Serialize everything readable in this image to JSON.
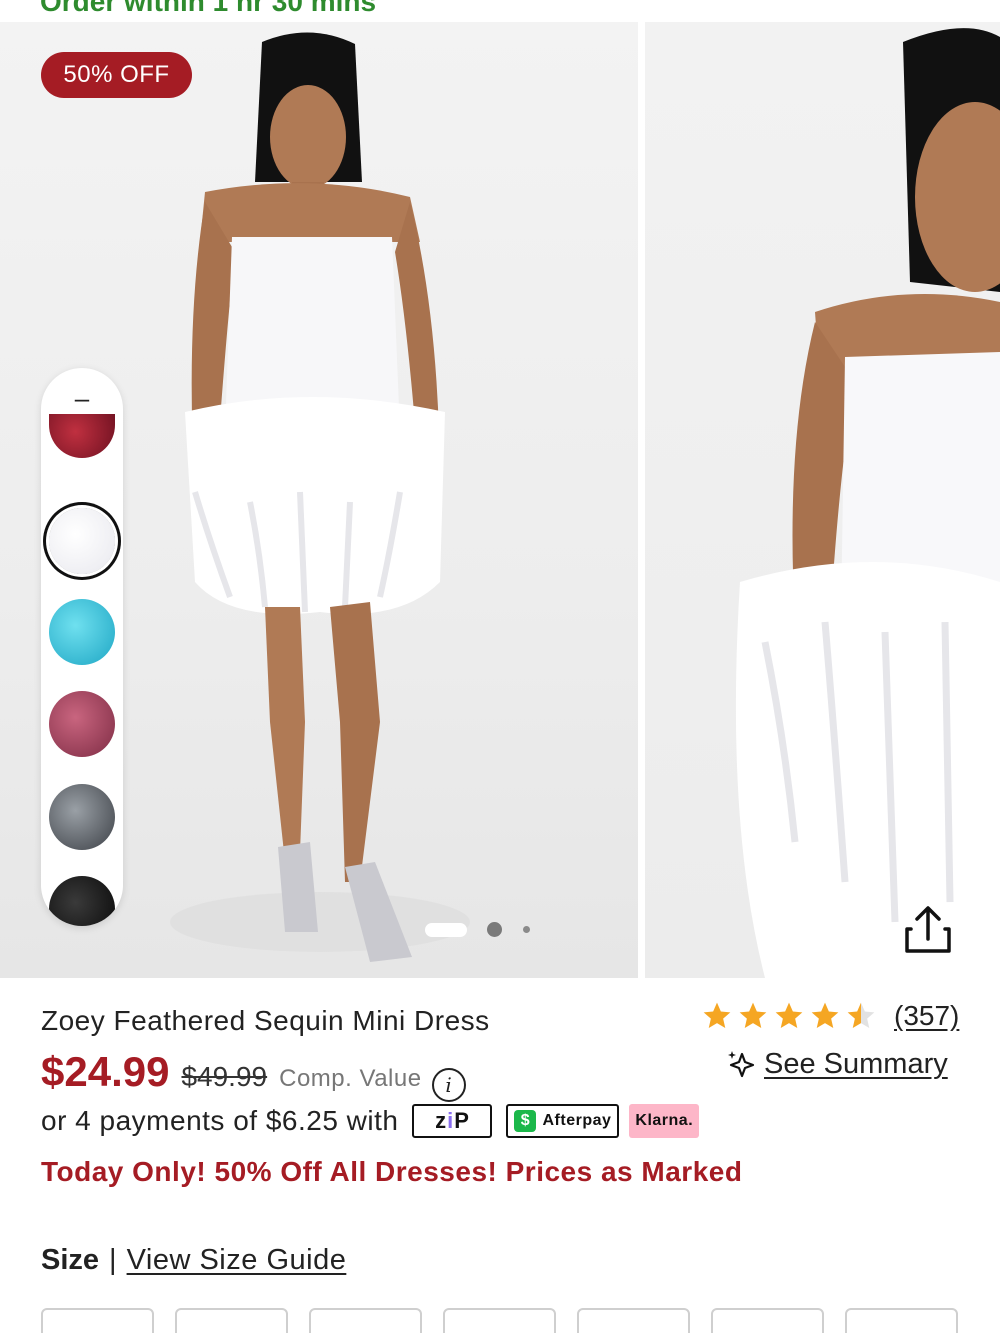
{
  "banner": {
    "text": "Order within 1 hr 30 mins"
  },
  "gallery": {
    "badge": "50% OFF",
    "swatch_collapse": "–",
    "swatches": [
      {
        "name": "red-sequin",
        "color": "#8e1d2a"
      },
      {
        "name": "white",
        "color": "#f4f4f6",
        "selected": true
      },
      {
        "name": "turquoise",
        "color": "#3ec7dc"
      },
      {
        "name": "rose",
        "color": "#a8445e"
      },
      {
        "name": "silver",
        "color": "#6d7278"
      },
      {
        "name": "black",
        "color": "#121212"
      }
    ],
    "carousel": {
      "current": 1,
      "total": 3
    }
  },
  "product": {
    "name": "Zoey Feathered Sequin Mini Dress",
    "rating": 4.5,
    "review_count": "(357)",
    "price_sale": "$24.99",
    "price_original": "$49.99",
    "comp_value": "Comp. Value",
    "summary_label": "See Summary",
    "payments_text": "or 4 payments of $6.25 with",
    "pay_zip_a": "z",
    "pay_zip_b": "i",
    "pay_zip_c": "P",
    "pay_afterpay": "Afterpay",
    "pay_klarna": "Klarna.",
    "promo": "Today Only! 50% Off All Dresses! Prices as Marked"
  },
  "size": {
    "label": "Size",
    "separator": "|",
    "guide": "View Size Guide",
    "options": [
      "",
      "",
      "",
      "",
      "",
      "",
      ""
    ]
  },
  "colors": {
    "accent": "#a51c24",
    "banner_green": "#2e8b2e",
    "star": "#f5a623"
  }
}
